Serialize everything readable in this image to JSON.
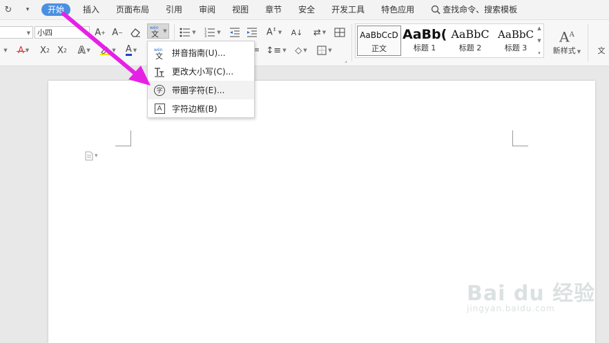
{
  "menubar": {
    "tabs": [
      {
        "label": "开始",
        "active": true
      },
      {
        "label": "插入"
      },
      {
        "label": "页面布局"
      },
      {
        "label": "引用"
      },
      {
        "label": "审阅"
      },
      {
        "label": "视图"
      },
      {
        "label": "章节"
      },
      {
        "label": "安全"
      },
      {
        "label": "开发工具"
      },
      {
        "label": "特色应用"
      }
    ],
    "search_label": "查找命令、搜索模板",
    "quick_icons": [
      "redo-icon",
      "customize-dropdown-icon"
    ]
  },
  "ribbon": {
    "font_size_value": "小四",
    "styles": [
      {
        "sample": "AaBbCcD",
        "label": "正文",
        "selected": true
      },
      {
        "sample": "AaBb(",
        "label": "标题 1"
      },
      {
        "sample": "AaBbC",
        "label": "标题 2"
      },
      {
        "sample": "AaBbC",
        "label": "标题 3"
      }
    ],
    "new_style_label": "新样式",
    "text_tool_label": "文",
    "icons": {
      "grow_font": "A⁺",
      "shrink_font": "A⁻",
      "clear_format": "eraser-icon",
      "phonetic_guide": "wén/文",
      "strikethrough": "A",
      "superscript": "X²",
      "subscript": "X₂",
      "font_color": "A",
      "highlight": "highlighter-icon",
      "text_effect": "A"
    }
  },
  "dropdown": {
    "items": [
      {
        "label": "拼音指南(U)...",
        "icon": "pinyin-icon"
      },
      {
        "label": "更改大小写(C)...",
        "icon": "change-case-icon"
      },
      {
        "label": "带圈字符(E)...",
        "icon": "enclosed-char-icon",
        "icon_text": "字"
      },
      {
        "label": "字符边框(B)",
        "icon": "char-border-icon",
        "icon_text": "A"
      }
    ]
  },
  "colors": {
    "accent": "#4a90e2",
    "annotation_arrow": "#e621e6",
    "font_color_underline": "#1a3fd6",
    "strike_color": "#d43a3a"
  },
  "watermark": {
    "main": "Bai du 经验",
    "sub": "jingyan.baidu.com"
  }
}
